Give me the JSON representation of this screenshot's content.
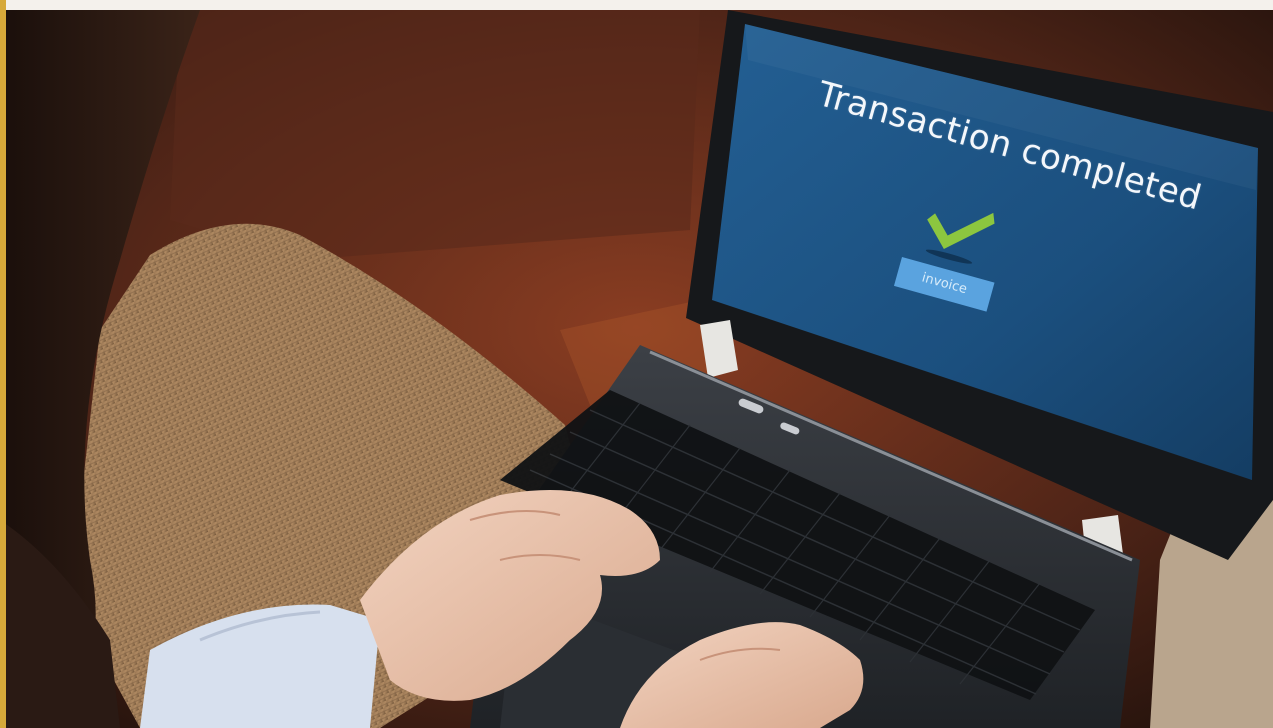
{
  "screen": {
    "title": "Transaction completed",
    "button_label": "invoice",
    "status_icon": "check-icon"
  },
  "colors": {
    "screen_blue": "#1b4f7e",
    "check_green": "#8cc63f",
    "button_blue": "#5aa3df",
    "accent_bar": "#d6a93a"
  }
}
